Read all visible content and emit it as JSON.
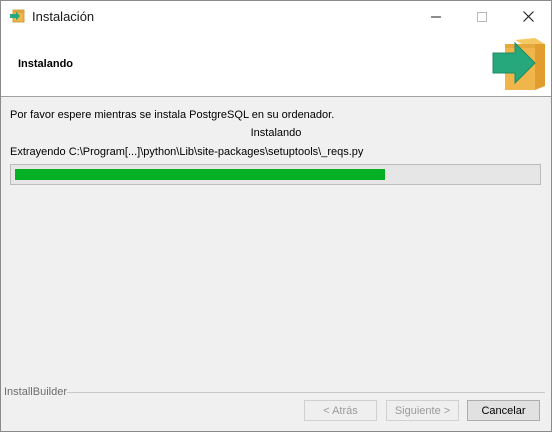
{
  "window": {
    "title": "Instalación",
    "icon": "installer-box-icon"
  },
  "header": {
    "title": "Instalando",
    "icon": "installer-arrow-box-icon"
  },
  "body": {
    "message": "Por favor espere mientras se instala PostgreSQL en su ordenador.",
    "status": "Instalando",
    "detail": "Extrayendo C:\\Program[...]\\python\\Lib\\site-packages\\setuptools\\_reqs.py",
    "progress_fraction": 0.71
  },
  "footer": {
    "brand": "InstallBuilder",
    "back_label": "< Atrás",
    "next_label": "Siguiente >",
    "cancel_label": "Cancelar"
  },
  "colors": {
    "progress": "#06b025",
    "box_orange": "#f0b64b",
    "arrow_green": "#27a87c"
  }
}
